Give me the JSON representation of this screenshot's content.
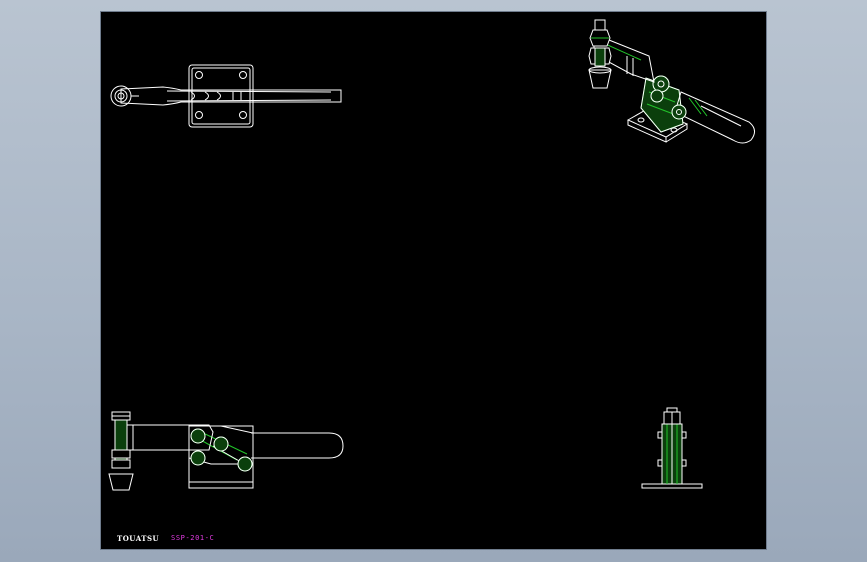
{
  "drawing": {
    "brand": "TOUATSU",
    "part_number": "SSP-201-C"
  },
  "colors": {
    "background": "#a9b6c6",
    "sheet": "#000000",
    "outline": "#ffffff",
    "highlight": "#22c52a",
    "part_number_text": "#e03be0"
  },
  "views": [
    {
      "id": "top-view"
    },
    {
      "id": "isometric-view"
    },
    {
      "id": "front-view"
    },
    {
      "id": "side-view"
    }
  ]
}
